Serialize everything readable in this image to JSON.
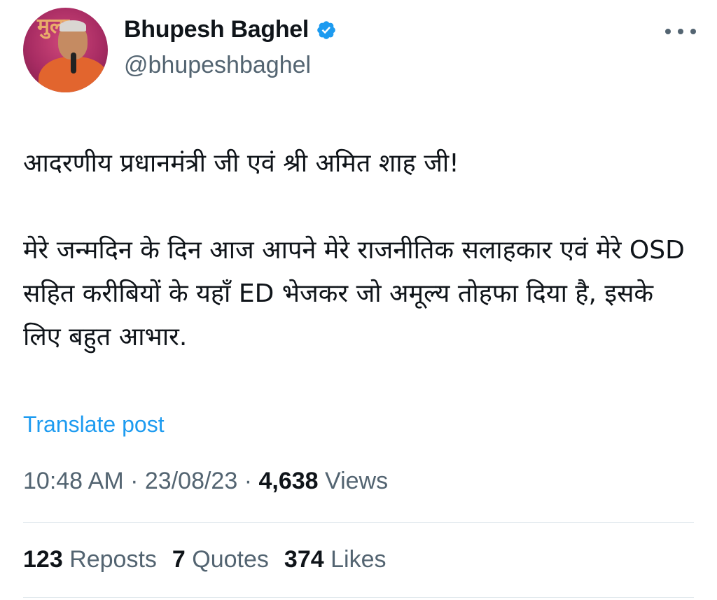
{
  "author": {
    "display_name": "Bhupesh Baghel",
    "handle": "@bhupeshbaghel",
    "verified": true,
    "avatar_text": "मुला"
  },
  "tweet": {
    "text": "आदरणीय प्रधानमंत्री जी एवं श्री अमित शाह जी!\n\nमेरे जन्मदिन के दिन आज आपने मेरे राजनीतिक सलाहकार एवं मेरे OSD सहित करीबियों के यहाँ ED भेजकर जो अमूल्य तोहफा दिया है, इसके लिए बहुत आभार.",
    "translate_label": "Translate post"
  },
  "meta": {
    "time": "10:48 AM",
    "separator": "·",
    "date": "23/08/23",
    "views_count": "4,638",
    "views_label": "Views"
  },
  "stats": {
    "reposts_count": "123",
    "reposts_label": "Reposts",
    "quotes_count": "7",
    "quotes_label": "Quotes",
    "likes_count": "374",
    "likes_label": "Likes"
  },
  "icons": {
    "verified": "verified-badge-icon",
    "more": "more-options-icon"
  },
  "colors": {
    "accent": "#1d9bf0",
    "secondary_text": "#536471",
    "primary_text": "#0f1419"
  }
}
